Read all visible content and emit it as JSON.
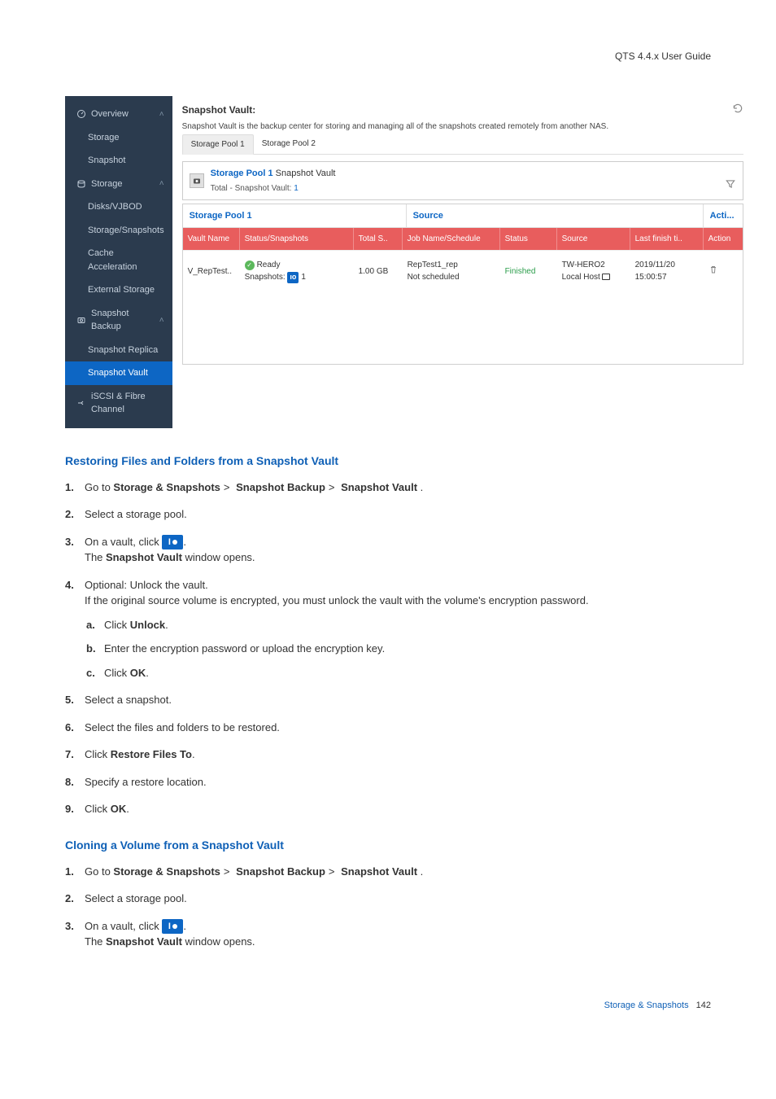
{
  "header": {
    "guide": "QTS 4.4.x User Guide"
  },
  "screenshot": {
    "sidebar": {
      "overview": "Overview",
      "storage0": "Storage",
      "snapshot": "Snapshot",
      "storage": "Storage",
      "disks": "Disks/VJBOD",
      "storsnap": "Storage/Snapshots",
      "cache": "Cache Acceleration",
      "ext": "External Storage",
      "sbackup": "Snapshot Backup",
      "sreplica": "Snapshot Replica",
      "svault": "Snapshot Vault",
      "iscsi": "iSCSI & Fibre Channel"
    },
    "main": {
      "title": "Snapshot Vault:",
      "desc": "Snapshot Vault is the backup center for storing and managing all of the snapshots created remotely from another NAS.",
      "tab1": "Storage Pool 1",
      "tab2": "Storage Pool 2",
      "poolHeader": {
        "name": "Storage Pool 1",
        "svLabel": " Snapshot Vault",
        "totalLabel": "Total - Snapshot Vault: ",
        "total": "1"
      },
      "table": {
        "grp1": "Storage Pool 1",
        "grp2": "Source",
        "grp3": "Acti...",
        "cols": {
          "vn": "Vault Name",
          "ss": "Status/Snapshots",
          "ts": "Total S..",
          "js": "Job Name/Schedule",
          "st": "Status",
          "sr": "Source",
          "lf": "Last finish ti..",
          "ac": "Action"
        },
        "row": {
          "vn": "V_RepTest..",
          "ssReady": "Ready",
          "ssSnap": "Snapshots: ",
          "ssCount": "1",
          "ts": "1.00 GB",
          "jsName": "RepTest1_rep",
          "jsSched": "Not scheduled",
          "st": "Finished",
          "srHost": "TW-HERO2",
          "srLoc": "Local Host",
          "lfDate": "2019/11/20",
          "lfTime": "15:00:57"
        }
      }
    }
  },
  "sec1": {
    "title": "Restoring Files and Folders from a Snapshot Vault",
    "steps": {
      "s1a": "Go to ",
      "s1b": "Storage & Snapshots",
      "s1c": "Snapshot Backup",
      "s1d": "Snapshot Vault",
      "s1e": " .",
      "s2": "Select a storage pool.",
      "s3a": "On a vault, click ",
      "s3b": ".",
      "s3c": "The ",
      "s3d": "Snapshot Vault",
      "s3e": " window opens.",
      "s4a": "Optional: Unlock the vault.",
      "s4b": "If the original source volume is encrypted, you must unlock the vault with the volume's encryption password.",
      "s4sa1": "Click ",
      "s4sa2": "Unlock",
      "s4sa3": ".",
      "s4sb": "Enter the encryption password or upload the encryption key.",
      "s4sc1": "Click ",
      "s4sc2": "OK",
      "s4sc3": ".",
      "s5": "Select a snapshot.",
      "s6": "Select the files and folders to be restored.",
      "s7a": "Click ",
      "s7b": "Restore Files To",
      "s7c": ".",
      "s8": "Specify a restore location.",
      "s9a": "Click ",
      "s9b": "OK",
      "s9c": "."
    }
  },
  "sec2": {
    "title": "Cloning a Volume from a Snapshot Vault",
    "steps": {
      "s1a": "Go to ",
      "s1b": "Storage & Snapshots",
      "s1c": "Snapshot Backup",
      "s1d": "Snapshot Vault",
      "s1e": " .",
      "s2": "Select a storage pool.",
      "s3a": "On a vault, click ",
      "s3b": ".",
      "s3c": "The ",
      "s3d": "Snapshot Vault",
      "s3e": " window opens."
    }
  },
  "footer": {
    "section": "Storage & Snapshots",
    "page": "142"
  }
}
